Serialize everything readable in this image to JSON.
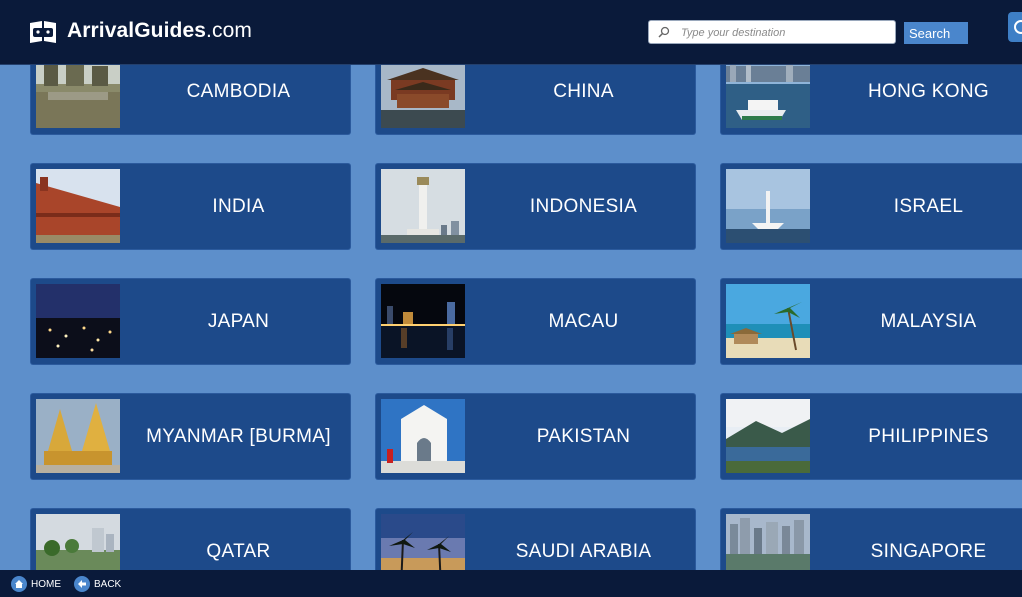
{
  "header": {
    "brand_bold": "ArrivalGuides",
    "brand_light": ".com",
    "search_placeholder": "Type your destination",
    "search_button": "Search"
  },
  "destinations": [
    {
      "label": "CAMBODIA",
      "thumb": "temple-ruins-photo"
    },
    {
      "label": "CHINA",
      "thumb": "pagoda-photo"
    },
    {
      "label": "HONG KONG",
      "thumb": "ferry-harbour-photo"
    },
    {
      "label": "INDIA",
      "thumb": "red-fort-photo"
    },
    {
      "label": "INDONESIA",
      "thumb": "monument-tower-photo"
    },
    {
      "label": "ISRAEL",
      "thumb": "observatory-sea-photo"
    },
    {
      "label": "JAPAN",
      "thumb": "night-city-photo"
    },
    {
      "label": "MACAU",
      "thumb": "night-waterfront-photo"
    },
    {
      "label": "MALAYSIA",
      "thumb": "tropical-beach-photo"
    },
    {
      "label": "MYANMAR [BURMA]",
      "thumb": "golden-pagoda-photo"
    },
    {
      "label": "PAKISTAN",
      "thumb": "white-mausoleum-photo"
    },
    {
      "label": "PHILIPPINES",
      "thumb": "mountain-lake-photo"
    },
    {
      "label": "QATAR",
      "thumb": "coastal-skyline-photo"
    },
    {
      "label": "SAUDI ARABIA",
      "thumb": "palm-trees-photo"
    },
    {
      "label": "SINGAPORE",
      "thumb": "city-skyline-photo"
    }
  ],
  "footer": {
    "home": "HOME",
    "back": "BACK"
  }
}
